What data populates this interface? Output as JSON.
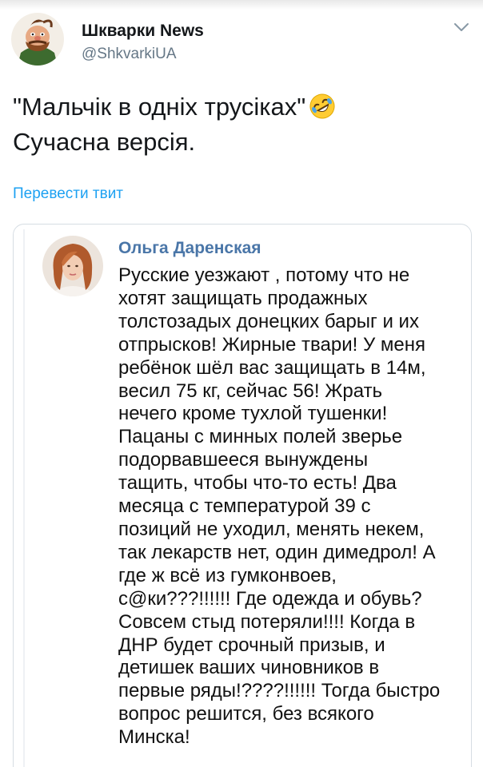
{
  "tweet": {
    "author_name": "Шкварки News",
    "author_handle": "@ShkvarkiUA",
    "text_line1": "\"Мальчік в одніх трусіках\"",
    "text_line2": "Сучасна версія.",
    "emoji_icon": "rolling-on-floor-laughing-emoji",
    "translate_label": "Перевести твит"
  },
  "embed": {
    "author_name": "Ольга Даренская",
    "lines": [
      "Русские уезжают , потому что не",
      "хотят защищать продажных",
      "толстозадых донецких барыг и их",
      "отпрысков! Жирные твари! У меня",
      "ребёнок шёл вас защищать в 14м,",
      "весил 75 кг, сейчас 56! Жрать",
      "нечего кроме тухлой тушенки!",
      "Пацаны с минных полей зверье",
      "подорвавшееся вынуждены",
      "тащить, чтобы что-то есть! Два",
      "месяца с температурой 39 с",
      "позиций не уходил, менять некем,",
      "так лекарств нет, один димедрол! А",
      "где ж всё из гумконвоев,",
      "с@ки???!!!!!! Где одежда и обувь?",
      "Совсем стыд потеряли!!!! Когда в",
      "ДНР будет срочный призыв, и",
      "детишек ваших чиновников в",
      "первые ряды!????!!!!!! Тогда быстро",
      "вопрос решится, без всякого",
      "Минска!"
    ]
  },
  "colors": {
    "name": "#14171a",
    "handle": "#657786",
    "link": "#1da1f2",
    "embed_name": "#4a76a8"
  }
}
